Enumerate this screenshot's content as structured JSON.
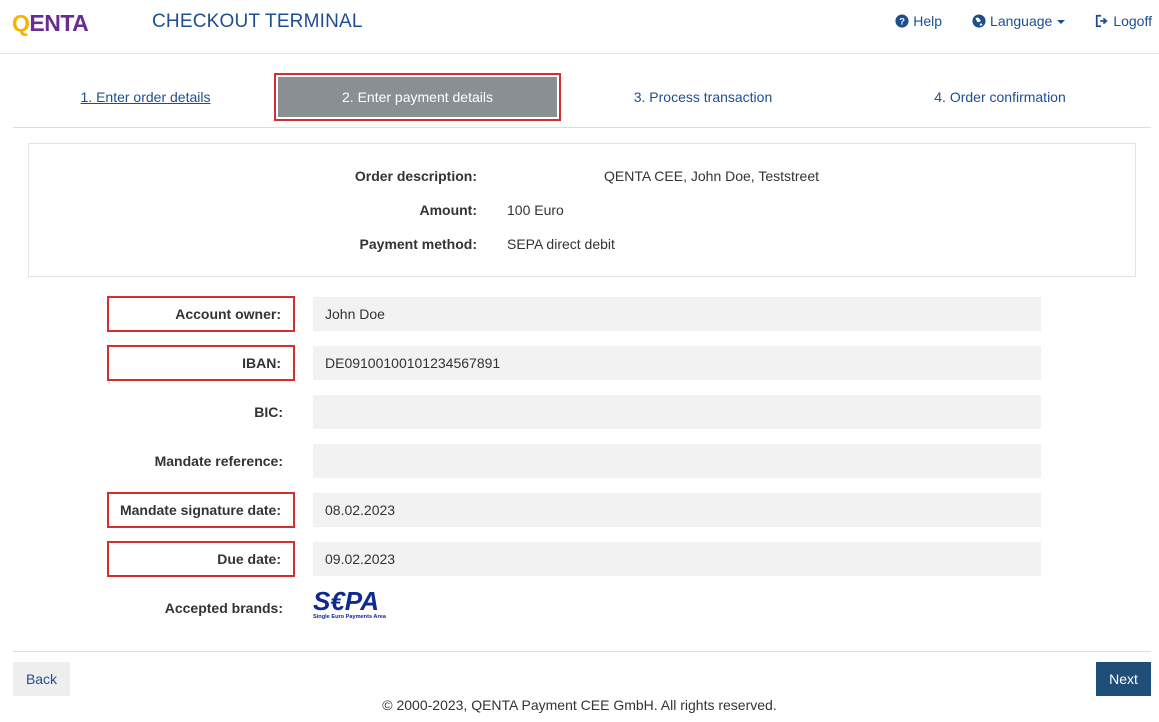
{
  "header": {
    "logo_first": "Q",
    "logo_rest": "ENTA",
    "title": "CHECKOUT TERMINAL",
    "nav": {
      "help": "Help",
      "language": "Language",
      "logoff": "Logoff"
    }
  },
  "steps": [
    {
      "label": "1. Enter order details"
    },
    {
      "label": "2. Enter payment details"
    },
    {
      "label": "3. Process transaction"
    },
    {
      "label": "4. Order confirmation"
    }
  ],
  "summary": {
    "order_description_label": "Order description:",
    "order_description_value": "QENTA CEE, John Doe, Teststreet",
    "amount_label": "Amount:",
    "amount_value": "100 Euro",
    "payment_method_label": "Payment method:",
    "payment_method_value": "SEPA direct debit"
  },
  "form": {
    "account_owner_label": "Account owner:",
    "account_owner_value": "John Doe",
    "iban_label": "IBAN:",
    "iban_value": "DE09100100101234567891",
    "bic_label": "BIC:",
    "bic_value": "",
    "mandate_reference_label": "Mandate reference:",
    "mandate_reference_value": "",
    "mandate_signature_date_label": "Mandate signature date:",
    "mandate_signature_date_value": "08.02.2023",
    "due_date_label": "Due date:",
    "due_date_value": "09.02.2023",
    "accepted_brands_label": "Accepted brands:",
    "sepa_logo_text": "S€PA",
    "sepa_logo_subtext": "Single Euro Payments Area"
  },
  "buttons": {
    "back": "Back",
    "next": "Next"
  },
  "footer": "© 2000-2023, QENTA Payment CEE GmbH. All rights reserved.",
  "colors": {
    "brand_blue": "#1d4f8f",
    "highlight_red": "#d32f2f",
    "active_step": "#8a8f93",
    "next_button": "#1f4e79",
    "logo_yellow": "#f4b400",
    "logo_purple": "#6b2c91"
  }
}
